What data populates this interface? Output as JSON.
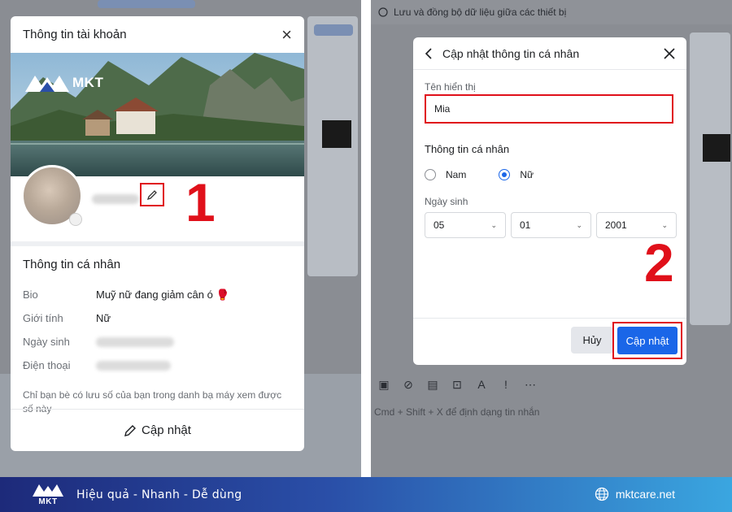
{
  "left": {
    "modal_title": "Thông tin tài khoản",
    "close_label": "×",
    "logo_text": "MKT",
    "step_number": "1",
    "info_title": "Thông tin cá nhân",
    "rows": [
      {
        "label": "Bio",
        "value": "Muỹ nữ đang giảm cân ó 🥊"
      },
      {
        "label": "Giới tính",
        "value": "Nữ"
      },
      {
        "label": "Ngày sinh",
        "value": ""
      },
      {
        "label": "Điện thoại",
        "value": ""
      }
    ],
    "note": "Chỉ bạn bè có lưu số của bạn trong danh bạ máy xem được số này",
    "update_label": "Cập nhật"
  },
  "right": {
    "top_text": "Lưu và đồng bộ dữ liệu giữa các thiết bị",
    "modal_title": "Cập nhật thông tin cá nhân",
    "display_name_label": "Tên hiển thị",
    "display_name_value": "Mia",
    "section_title": "Thông tin cá nhân",
    "gender_options": [
      {
        "label": "Nam",
        "selected": false
      },
      {
        "label": "Nữ",
        "selected": true
      }
    ],
    "dob_label": "Ngày sinh",
    "dob": {
      "day": "05",
      "month": "01",
      "year": "2001"
    },
    "cancel_label": "Hủy",
    "submit_label": "Cập nhật",
    "step_number": "2",
    "hint": "Cmd + Shift + X để định dạng tin nhắn"
  },
  "banner": {
    "slogan": "Hiệu quả - Nhanh - Dễ dùng",
    "site": "mktcare.net",
    "logo_text": "MKT"
  },
  "colors": {
    "accent_blue": "#1a66e8",
    "highlight_red": "#e0101a",
    "banner_start": "#1d2a7a",
    "banner_end": "#3aa6e0"
  }
}
